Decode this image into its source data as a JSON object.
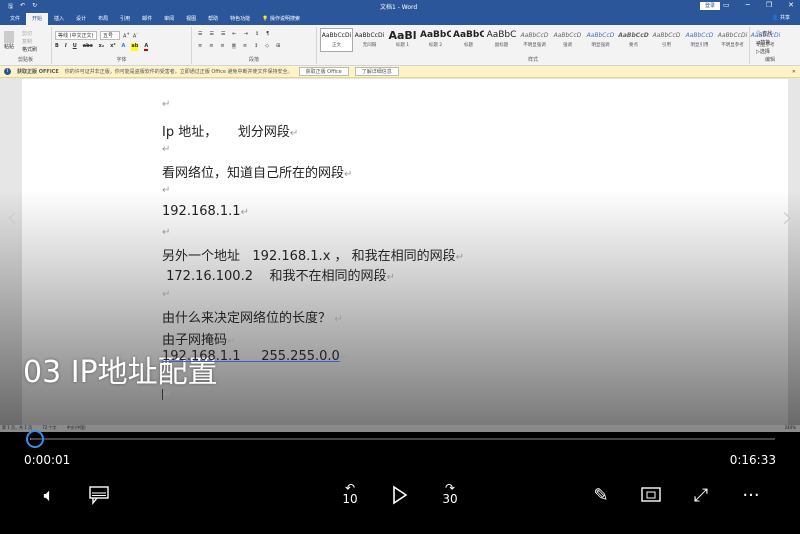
{
  "word": {
    "title": "文档1 - Word",
    "login": "登录",
    "share": "共享",
    "tabs": [
      "文件",
      "开始",
      "插入",
      "设计",
      "布局",
      "引用",
      "邮件",
      "审阅",
      "视图",
      "帮助",
      "特色功能",
      "操作说明搜索"
    ],
    "font_name": "等线 (中文正文)",
    "font_size": "五号",
    "clipboard": {
      "paste": "粘贴",
      "cut": "剪切",
      "copy": "复制",
      "format_painter": "格式刷"
    },
    "groups": [
      "剪贴板",
      "字体",
      "段落",
      "样式",
      "编辑"
    ],
    "styles": [
      {
        "preview": "AaBbCcDi",
        "name": "正文"
      },
      {
        "preview": "AaBbCcDi",
        "name": "无间隔"
      },
      {
        "preview": "AaBl",
        "name": "标题 1"
      },
      {
        "preview": "AaBbC",
        "name": "标题 2"
      },
      {
        "preview": "AaBbC",
        "name": "标题"
      },
      {
        "preview": "AaBbC",
        "name": "副标题"
      },
      {
        "preview": "AaBbCcD",
        "name": "不明显强调"
      },
      {
        "preview": "AaBbCcD",
        "name": "强调"
      },
      {
        "preview": "AaBbCcD",
        "name": "明显强调"
      },
      {
        "preview": "AaBbCcD",
        "name": "要点"
      },
      {
        "preview": "AaBbCcD",
        "name": "引用"
      },
      {
        "preview": "AaBbCcD",
        "name": "明显引用"
      },
      {
        "preview": "AaBbCcDi",
        "name": "不明显参考"
      },
      {
        "preview": "AaBbCcDi",
        "name": "明显参考"
      }
    ],
    "editing": [
      "查找",
      "替换",
      "选择"
    ],
    "message": {
      "label": "获取正版 OFFICE",
      "text": "你的许可证并非正版，你可能是盗版软件的受害者。立即通过正版 Office 避免中断并使文件保持安全。",
      "btn1": "获取正版 Office",
      "btn2": "了解详细信息"
    },
    "doc_lines": [
      "Ip 地址，     划分网段",
      "看网络位，知道自己所在的网段",
      "192.168.1.1",
      "另外一个地址   192.168.1.x ， 和我在相同的网段",
      " 172.16.100.2    和我不在相同的网段",
      "由什么来决定网络位的长度？",
      "由子网掩码",
      "192.168.1.1     255.255.0.0"
    ],
    "status": {
      "page": "第 1 页，共 1 页",
      "words": "72 个字",
      "lang": "中文(中国)",
      "zoom": "240%"
    }
  },
  "player": {
    "video_title": "03 IP地址配置",
    "elapsed": "0:00:01",
    "duration": "0:16:33",
    "progress": 0.001,
    "skip_back": "10",
    "skip_forward": "30",
    "accent": "#3a8ee6"
  }
}
